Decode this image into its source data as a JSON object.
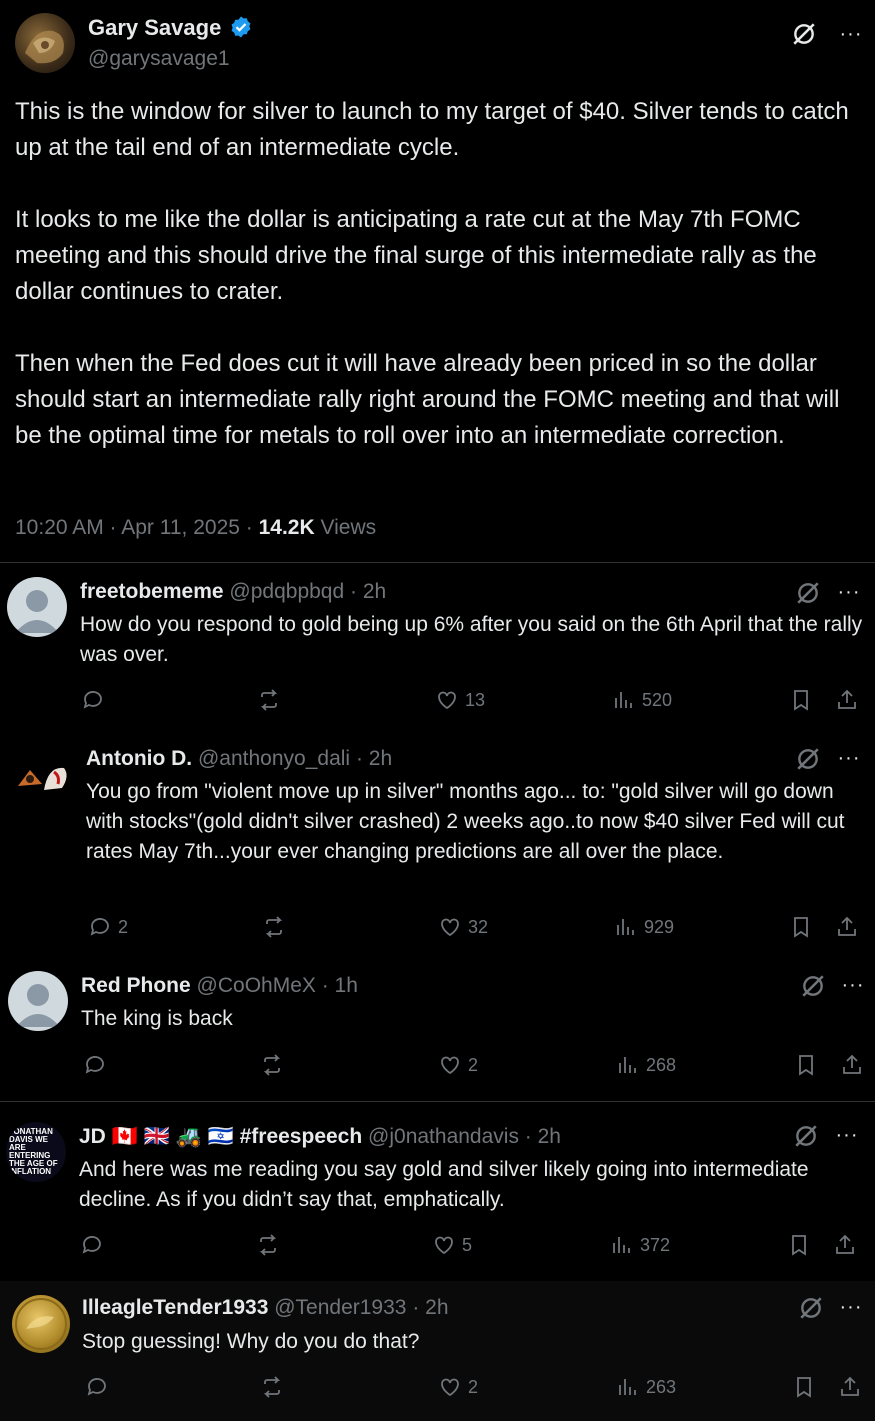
{
  "main_post": {
    "author_name": "Gary Savage",
    "author_handle": "@garysavage1",
    "paragraphs": [
      "This is the window for silver to launch to my target of $40. Silver tends to catch up at the tail end of an intermediate cycle.",
      "It looks to me like the dollar is anticipating a rate cut at the May 7th FOMC meeting and this should drive the final surge of this intermediate rally as the dollar continues to crater.",
      "Then when the Fed does cut it will have already been priced in so the dollar should start an intermediate rally right around the FOMC meeting and that will be the optimal time for metals to roll over into an intermediate correction."
    ],
    "timestamp": "10:20 AM · Apr 11, 2025 · ",
    "views_count": "14.2K",
    "views_label": " Views"
  },
  "replies": [
    {
      "name": "freetobememe",
      "handle": "@pdqbpbqd",
      "time": "· 2h",
      "text": "How do you respond to gold being up 6% after you said on the 6th April that the rally was over.",
      "replies": "",
      "likes": "13",
      "views": "520"
    },
    {
      "name": "Antonio D.",
      "handle": "@anthonyo_dali",
      "time": "· 2h",
      "text": "You go from \"violent move up in silver\" months ago... to: \"gold silver will go down with stocks\"(gold didn't silver crashed) 2 weeks ago..to now $40 silver Fed will cut rates May 7th...your ever changing predictions are all over the place.",
      "replies": "2",
      "likes": "32",
      "views": "929"
    },
    {
      "name": "Red Phone",
      "handle": "@CoOhMeX",
      "time": "· 1h",
      "text": "The king is back",
      "replies": "",
      "likes": "2",
      "views": "268"
    },
    {
      "name": "JD 🇨🇦 🇬🇧 🚜 🇮🇱 #freespeech",
      "handle": "@j0nathandavis",
      "time": "· 2h",
      "text": "And here was me reading you say gold and silver likely going into intermediate decline. As if you didn’t say that, emphatically.",
      "replies": "",
      "likes": "5",
      "views": "372",
      "avatar_text": "JONATHAN DAVIS WE ARE ENTERING THE AGE OF INFLATION"
    },
    {
      "name": "IlleagleTender1933",
      "handle": "@Tender1933",
      "time": "· 2h",
      "text": "Stop guessing! Why do you do that?",
      "replies": "",
      "likes": "2",
      "views": "263"
    }
  ],
  "colors": {
    "background": "#000000",
    "text": "#e7e9ea",
    "muted": "#71767b",
    "verified": "#1d9bf0",
    "divider": "#2f3336"
  }
}
